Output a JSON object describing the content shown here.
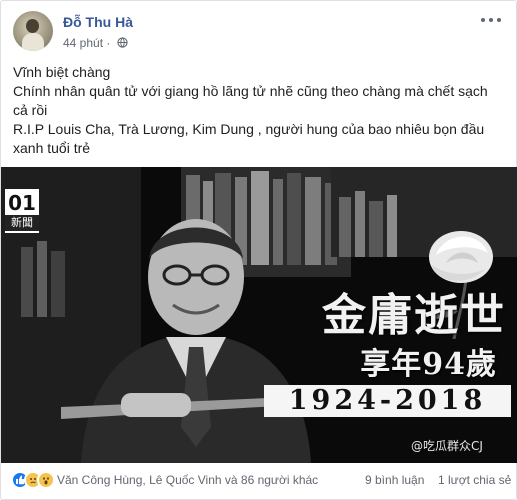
{
  "post": {
    "author": "Đỗ Thu Hà",
    "timestamp": "44 phút",
    "privacy_icon": "globe-icon",
    "more_icon": "more-dots-icon",
    "lines": [
      "Vĩnh biệt chàng",
      "Chính nhân quân tử với giang hồ lãng tử nhẽ cũng theo chàng mà chết sạch cả rồi",
      "R.I.P Louis Cha, Trà Lương, Kim Dung , người hung của bao nhiêu bọn đầu xanh tuổi trẻ"
    ]
  },
  "photo": {
    "logo_number": "01",
    "logo_text": "新聞",
    "title": "金庸逝世",
    "subtitle": "享年94歲",
    "years": "1924-2018",
    "watermark": "@吃瓜群众CJ"
  },
  "footer": {
    "reaction_icons": [
      "like-icon",
      "sad-icon",
      "wow-icon"
    ],
    "reaction_names": "Văn Công Hùng, Lê Quốc Vinh và 86 người khác",
    "comments": "9 bình luận",
    "shares": "1 lượt chia sẻ"
  },
  "colors": {
    "author_link": "#385898",
    "meta_text": "#616770",
    "like_blue": "#1877f2",
    "emoji_yellow": "#f7c34e",
    "photo_background": "#0a0a0a"
  }
}
